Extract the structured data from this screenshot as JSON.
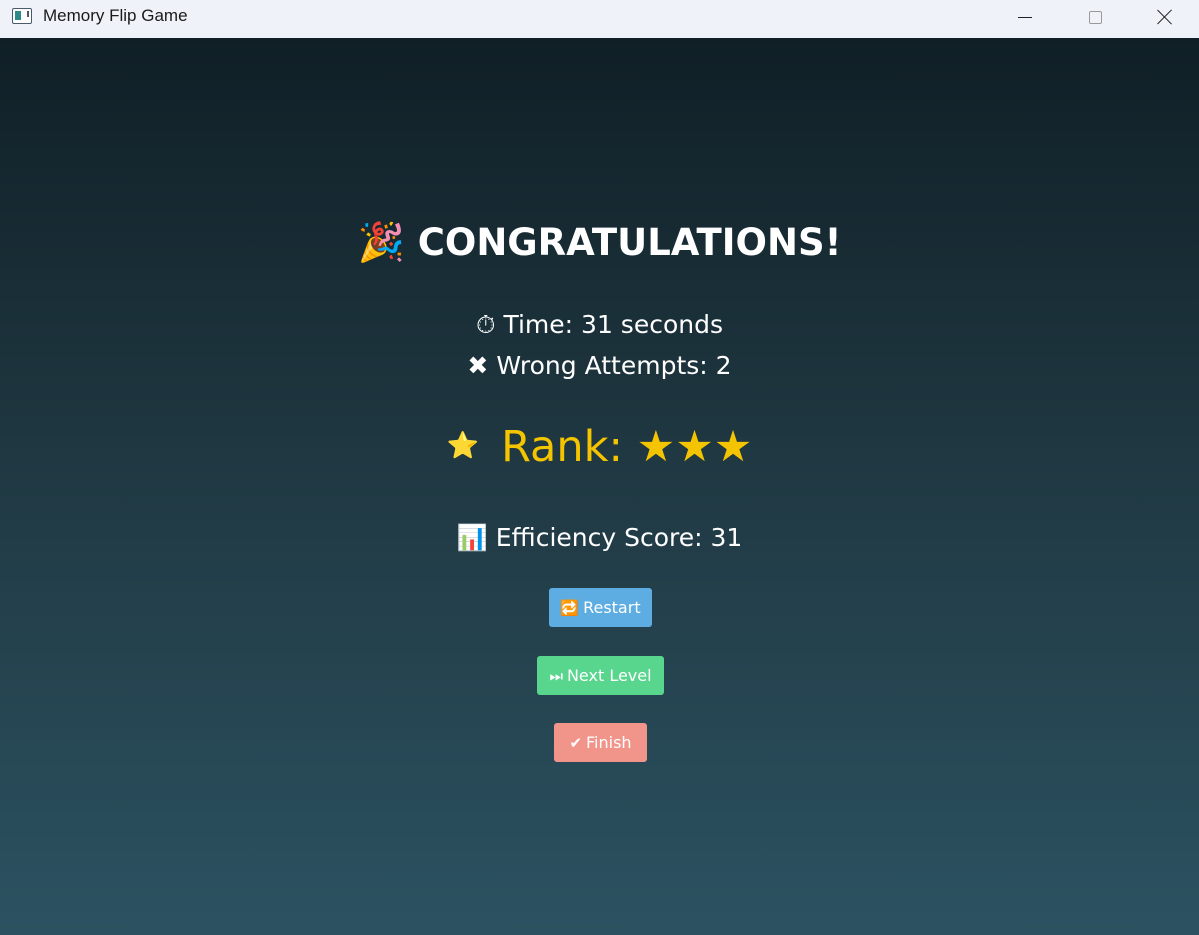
{
  "window": {
    "title": "Memory Flip Game",
    "controls": {
      "minimize": "minimize",
      "maximize": "maximize",
      "close": "close"
    }
  },
  "results": {
    "heading_icon": "🎉",
    "heading": "CONGRATULATIONS!",
    "time_icon": "⏱",
    "time_text": "Time: 31 seconds",
    "wrong_icon": "✖",
    "wrong_text": "Wrong Attempts: 2",
    "rank_icon": "⭐",
    "rank_text": "Rank: ★★★",
    "efficiency_icon": "📊",
    "efficiency_text": "Efficiency Score: 31"
  },
  "buttons": {
    "restart": {
      "icon": "🔁",
      "label": "Restart"
    },
    "next_level": {
      "icon": "⏭",
      "label": "Next Level"
    },
    "finish": {
      "icon": "✔",
      "label": "Finish"
    }
  },
  "colors": {
    "rank_gold": "#f5c400",
    "restart_bg": "#5dade2",
    "next_level_bg": "#58d68d",
    "finish_bg": "#f1948a",
    "bg_top": "#101f26",
    "bg_bottom": "#2c5261"
  }
}
